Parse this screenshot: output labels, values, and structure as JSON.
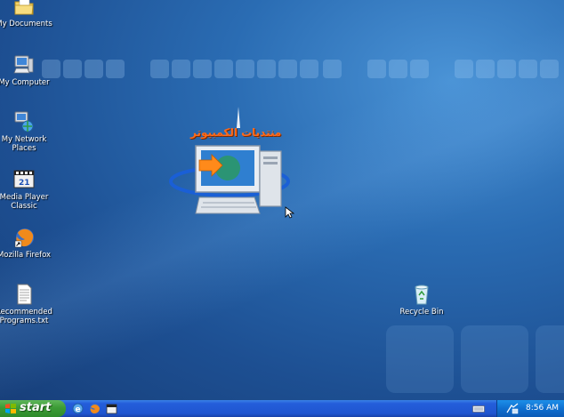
{
  "desktop": {
    "icons": [
      {
        "label": "My Documents",
        "icon": "folder-icon"
      },
      {
        "label": "My Computer",
        "icon": "computer-icon"
      },
      {
        "label": "My Network Places",
        "icon": "network-icon"
      },
      {
        "label": "Media Player Classic",
        "icon": "media-player-icon"
      },
      {
        "label": "Mozilla Firefox",
        "icon": "firefox-icon"
      },
      {
        "label": "Recommended Programs.txt",
        "icon": "text-file-icon"
      },
      {
        "label": "Recycle Bin",
        "icon": "recycle-bin-icon"
      }
    ],
    "logo_text": "منتديات الكمبيوتر"
  },
  "taskbar": {
    "start_label": "start",
    "clock": "8:56 AM"
  },
  "colors": {
    "desktop_bg": "#2a6cb3",
    "taskbar": "#245edb",
    "start_button": "#3c9b36",
    "tray": "#0f6fd0"
  }
}
